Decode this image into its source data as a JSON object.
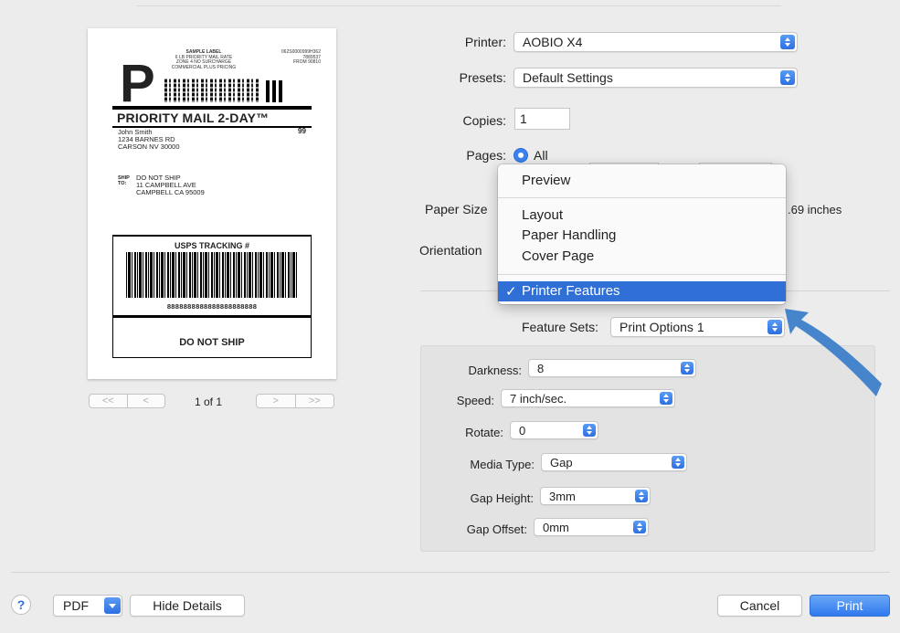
{
  "preview": {
    "label": {
      "service_letter": "P",
      "sample_header": [
        "SAMPLE LABEL",
        "6 LB PRIORITY MAIL RATE",
        "ZONE 4 NO SURCHARGE",
        "COMMERCIAL PLUS PRICING"
      ],
      "right_codes": [
        "062S0000999H362",
        "7889537",
        "FROM 90810"
      ],
      "service_title": "PRIORITY MAIL 2-DAY™",
      "from_lines": [
        "John Smith",
        "1234 BARNES RD",
        "CARSON NV 30000"
      ],
      "code_99": "99",
      "ship_to_label": [
        "SHIP",
        "TO:"
      ],
      "ship_to_lines": [
        "DO NOT SHIP",
        "11 CAMPBELL AVE",
        "CAMPBELL CA 95009"
      ],
      "tracking_title": "USPS TRACKING #",
      "tracking_number": "8888888888888888888888",
      "footer_text": "DO NOT SHIP"
    },
    "pager": {
      "first": "<<",
      "prev": "<",
      "page_text": "1 of 1",
      "next": ">",
      "last": ">>"
    }
  },
  "form": {
    "printer_label": "Printer:",
    "printer_value": "AOBIO X4",
    "presets_label": "Presets:",
    "presets_value": "Default Settings",
    "copies_label": "Copies:",
    "copies_value": "1",
    "pages_label": "Pages:",
    "pages_all": "All",
    "paper_size_label": "Paper Size",
    "paper_size_suffix": ".69 inches",
    "orientation_label": "Orientation"
  },
  "menu": {
    "items": [
      "Preview",
      "Layout",
      "Paper Handling",
      "Cover Page",
      "Printer Features"
    ],
    "selected": "Printer Features",
    "check": "✓"
  },
  "feature_sets": {
    "label": "Feature Sets:",
    "value": "Print Options 1"
  },
  "options": {
    "darkness_label": "Darkness:",
    "darkness_value": "8",
    "speed_label": "Speed:",
    "speed_value": "7 inch/sec.",
    "rotate_label": "Rotate:",
    "rotate_value": "0",
    "media_type_label": "Media Type:",
    "media_type_value": "Gap",
    "gap_height_label": "Gap Height:",
    "gap_height_value": "3mm",
    "gap_offset_label": "Gap Offset:",
    "gap_offset_value": "0mm"
  },
  "footer": {
    "help": "?",
    "pdf": "PDF",
    "hide_details": "Hide Details",
    "cancel": "Cancel",
    "print": "Print"
  },
  "colors": {
    "accent": "#2f6fd6",
    "annotation_arrow": "#3d80c9",
    "window_bg": "#ececec"
  }
}
